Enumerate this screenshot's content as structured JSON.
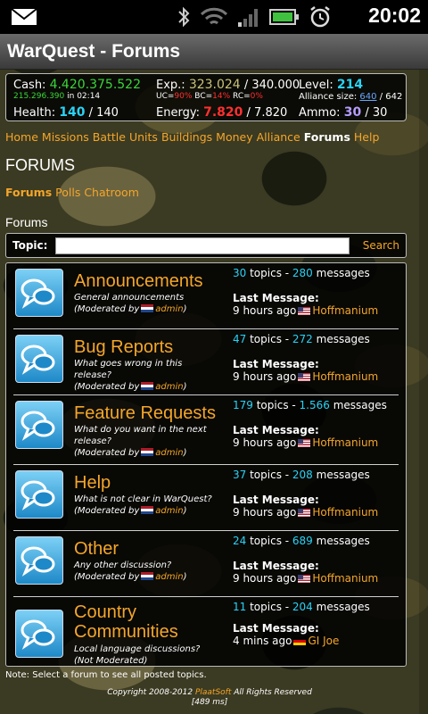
{
  "status_bar": {
    "time": "20:02",
    "icons": [
      "mail-icon",
      "bluetooth-icon",
      "wifi-icon",
      "signal-icon",
      "battery-icon",
      "alarm-icon"
    ]
  },
  "app": {
    "title": "WarQuest - Forums"
  },
  "stats": {
    "cash_label": "Cash:",
    "cash_value": "4.420.375.522",
    "cash_sub": "215.296.390",
    "cash_sub_in": "in 02:14",
    "exp_label": "Exp.:",
    "exp_value": "323.024",
    "exp_max": "/ 340.000",
    "uc_label": "UC=",
    "uc_value": "90%",
    "bc_label": " BC=",
    "bc_value": "14%",
    "rc_label": " RC=",
    "rc_value": "0%",
    "level_label": "Level:",
    "level_value": "214",
    "alliance_label": "Alliance size:",
    "alliance_value": "640",
    "alliance_max": "/ 642",
    "health_label": "Health:",
    "health_value": "140",
    "health_max": "/ 140",
    "energy_label": "Energy:",
    "energy_value": "7.820",
    "energy_max": "/ 7.820",
    "ammo_label": "Ammo:",
    "ammo_value": "30",
    "ammo_max": "/ 30"
  },
  "nav": {
    "items": [
      "Home",
      "Missions",
      "Battle",
      "Units",
      "Buildings",
      "Money",
      "Alliance",
      "Forums",
      "Help"
    ],
    "active": "Forums"
  },
  "page_title": "FORUMS",
  "subnav": {
    "items": [
      "Forums",
      "Polls",
      "Chatroom"
    ]
  },
  "section_title": "Forums",
  "search": {
    "label": "Topic:",
    "value": "",
    "button": "Search"
  },
  "forums": [
    {
      "name": "Announcements",
      "desc": "General announcements",
      "moderated": "(Moderated by",
      "moderator": "admin",
      "close": ")",
      "topics": "30",
      "messages": "280",
      "last_label": "Last Message:",
      "last_time": "9 hours ago",
      "last_user": "Hoffmanium"
    },
    {
      "name": "Bug Reports",
      "desc": "What goes wrong in this release?",
      "moderated": "(Moderated by",
      "moderator": "admin",
      "close": ")",
      "topics": "47",
      "messages": "272",
      "last_label": "Last Message:",
      "last_time": "9 hours ago",
      "last_user": "Hoffmanium"
    },
    {
      "name": "Feature Requests",
      "desc": "What do you want in the next release?",
      "moderated": "(Moderated by",
      "moderator": "admin",
      "close": ")",
      "topics": "179",
      "messages": "1.566",
      "last_label": "Last Message:",
      "last_time": "9 hours ago",
      "last_user": "Hoffmanium"
    },
    {
      "name": "Help",
      "desc": "What is not clear in WarQuest?",
      "moderated": "(Moderated by",
      "moderator": "admin",
      "close": ")",
      "topics": "37",
      "messages": "208",
      "last_label": "Last Message:",
      "last_time": "9 hours ago",
      "last_user": "Hoffmanium"
    },
    {
      "name": "Other",
      "desc": "Any other discussion?",
      "moderated": "(Moderated by",
      "moderator": "admin",
      "close": ")",
      "topics": "24",
      "messages": "689",
      "last_label": "Last Message:",
      "last_time": "9 hours ago",
      "last_user": "Hoffmanium"
    },
    {
      "name": "Country Communities",
      "desc": "Local language discussions?",
      "moderated": "(Not Moderated)",
      "moderator": "",
      "close": "",
      "topics": "11",
      "messages": "204",
      "last_label": "Last Message:",
      "last_time": "4 mins ago",
      "last_user": "GI Joe"
    }
  ],
  "labels": {
    "topics": " topics - ",
    "messages": " messages"
  },
  "note": "Note: Select a forum to see all posted topics.",
  "footer": {
    "copyright": "Copyright 2008-2012",
    "company": "PlaatSoft",
    "rights": "All Rights Reserved",
    "timing": "[489 ms]"
  }
}
